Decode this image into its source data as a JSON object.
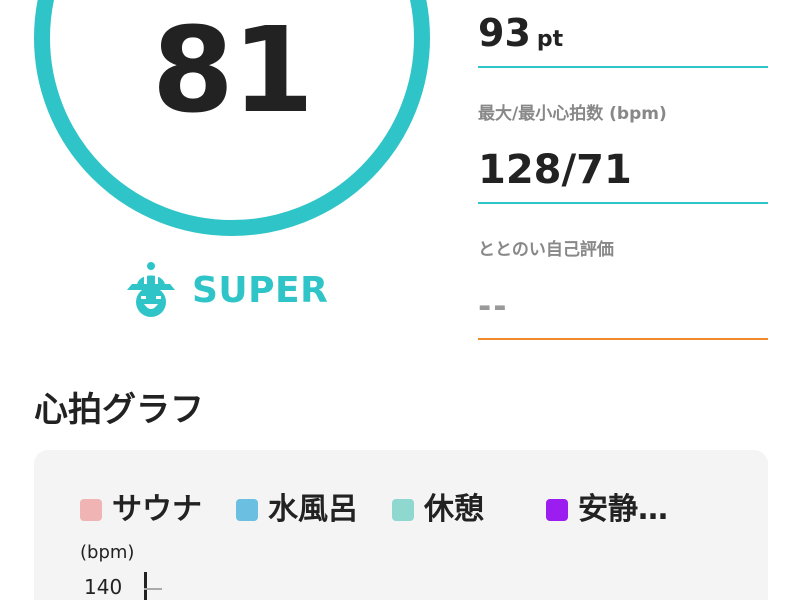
{
  "score": {
    "value": "81",
    "rank_label": "SUPER",
    "rank_icon": "sauna-hat-face-icon",
    "ring_color": "#2fc4c8"
  },
  "stats": {
    "points": {
      "value": "93",
      "unit": "pt"
    },
    "heart_rate": {
      "label": "最大/最小心拍数 (bpm)",
      "value": "128/71"
    },
    "self_rating": {
      "label": "ととのい自己評価",
      "value": "--"
    }
  },
  "graph": {
    "title": "心拍グラフ",
    "legend": [
      {
        "label": "サウナ",
        "color": "#f0b4b4"
      },
      {
        "label": "水風呂",
        "color": "#6bbfe0"
      },
      {
        "label": "休憩",
        "color": "#8fd8d0"
      },
      {
        "label": "安静…",
        "color": "#9b1df0"
      }
    ],
    "y_unit": "(bpm)",
    "y_ticks": [
      "140"
    ]
  },
  "colors": {
    "accent": "#2fc4c8",
    "warning": "#f08a2a",
    "text": "#222222",
    "muted": "#888888"
  }
}
